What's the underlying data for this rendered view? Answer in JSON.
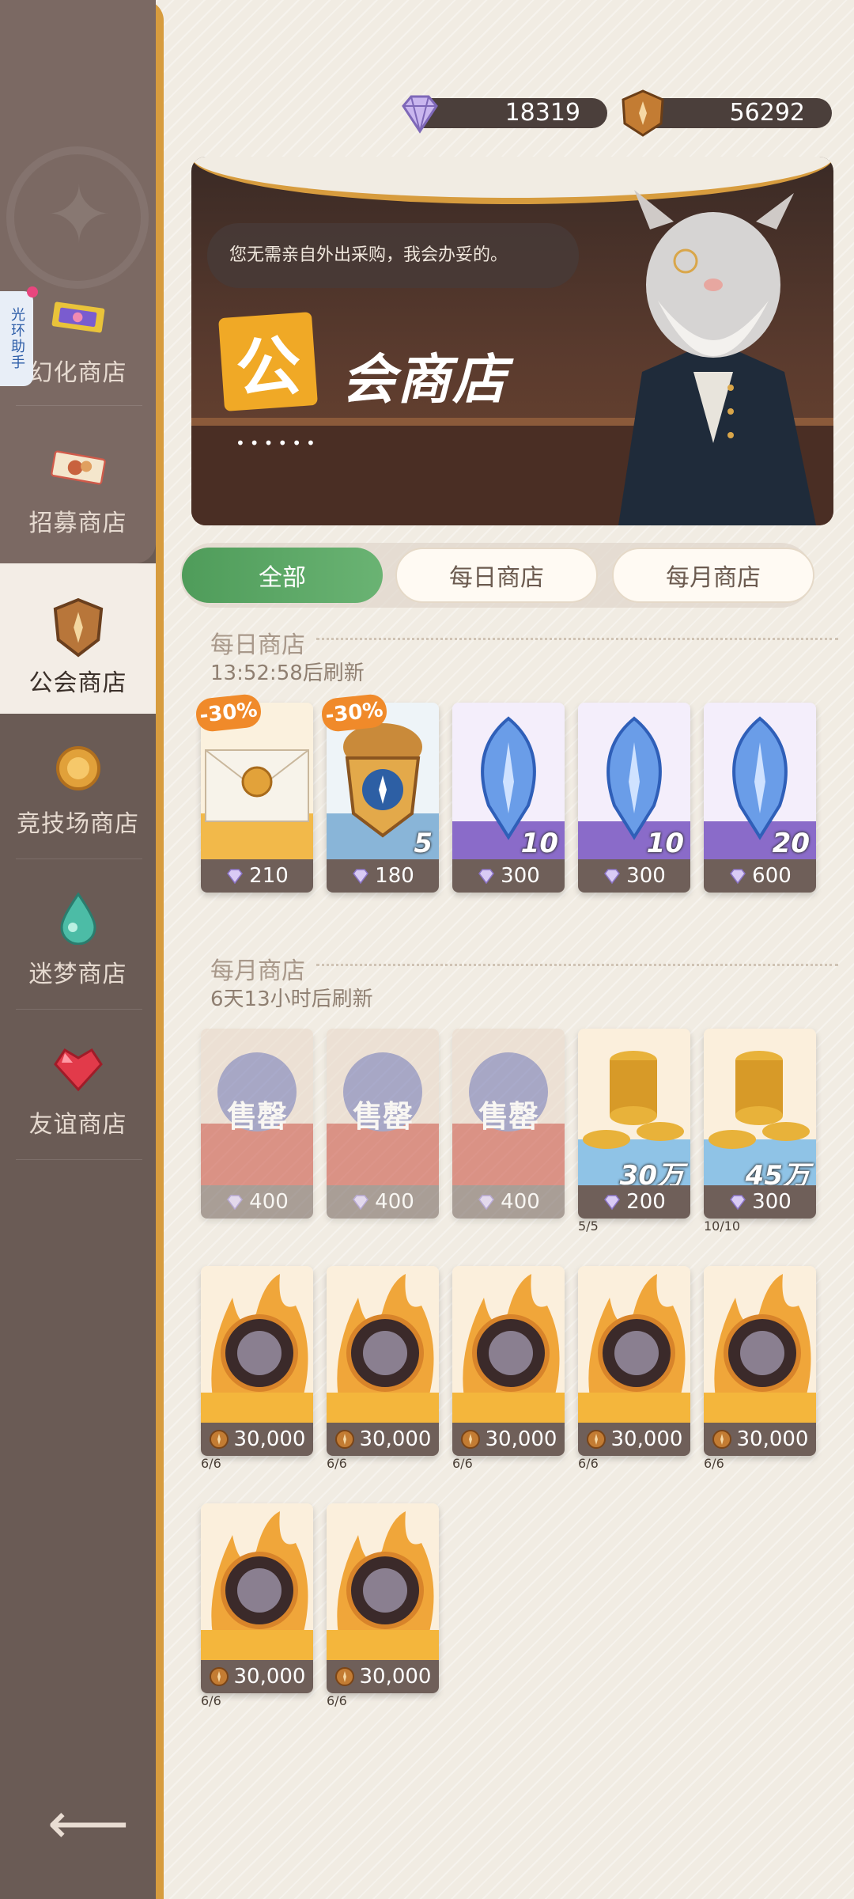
{
  "currencies": [
    {
      "name": "diamond",
      "value": "18319",
      "icon": "diamond-icon"
    },
    {
      "name": "guild-coin",
      "value": "56292",
      "icon": "guild-coin-icon"
    }
  ],
  "sidebar": {
    "helper_label": "光环助手",
    "items": [
      {
        "label": "幻化商店",
        "icon": "ticket-icon"
      },
      {
        "label": "招募商店",
        "icon": "recruit-ticket-icon"
      },
      {
        "label": "公会商店",
        "icon": "guild-shield-icon",
        "active": true
      },
      {
        "label": "竞技场商店",
        "icon": "arena-coin-icon"
      },
      {
        "label": "迷梦商店",
        "icon": "dream-drop-icon"
      },
      {
        "label": "友谊商店",
        "icon": "heart-gem-icon"
      }
    ]
  },
  "banner": {
    "speech": "您无需亲自外出采购，我会办妥的。",
    "title_first": "公",
    "title_rest": "会商店",
    "dots": "••••••"
  },
  "tabs": [
    {
      "label": "全部",
      "active": true
    },
    {
      "label": "每日商店",
      "active": false
    },
    {
      "label": "每月商店",
      "active": false
    }
  ],
  "daily": {
    "title": "每日商店",
    "refresh": "13:52:58后刷新",
    "items": [
      {
        "name": "letter",
        "discount": "-30%",
        "qty": "",
        "price": "210",
        "currency": "diamond",
        "color": "#f2b94a"
      },
      {
        "name": "acorn-badge",
        "discount": "-30%",
        "qty": "5",
        "price": "180",
        "currency": "diamond",
        "color": "#89b5d8"
      },
      {
        "name": "blue-crystal",
        "discount": "",
        "qty": "10",
        "price": "300",
        "currency": "diamond",
        "color": "#8a6bc9"
      },
      {
        "name": "blue-crystal",
        "discount": "",
        "qty": "10",
        "price": "300",
        "currency": "diamond",
        "color": "#8a6bc9"
      },
      {
        "name": "blue-crystal",
        "discount": "",
        "qty": "20",
        "price": "600",
        "currency": "diamond",
        "color": "#8a6bc9"
      }
    ]
  },
  "monthly": {
    "title": "每月商店",
    "refresh": "6天13小时后刷新",
    "sold_label": "售罄",
    "items": [
      {
        "name": "sold-item-1",
        "sold": true,
        "price": "400",
        "currency": "diamond",
        "limit": "",
        "qty": "",
        "color": "#c84a3a"
      },
      {
        "name": "sold-item-2",
        "sold": true,
        "price": "400",
        "currency": "diamond",
        "limit": "",
        "qty": "",
        "color": "#c84a3a"
      },
      {
        "name": "sold-item-3",
        "sold": true,
        "price": "400",
        "currency": "diamond",
        "limit": "",
        "qty": "",
        "color": "#c84a3a"
      },
      {
        "name": "gold-coins",
        "sold": false,
        "price": "200",
        "currency": "diamond",
        "limit": "5/5",
        "qty": "30万",
        "color": "#8fc3e6"
      },
      {
        "name": "gold-coins",
        "sold": false,
        "price": "300",
        "currency": "diamond",
        "limit": "10/10",
        "qty": "45万",
        "color": "#8fc3e6"
      },
      {
        "name": "hero-soul-1",
        "sold": false,
        "price": "30,000",
        "currency": "guild-coin",
        "limit": "6/6",
        "qty": "",
        "color": "#f0a63a"
      },
      {
        "name": "hero-soul-2",
        "sold": false,
        "price": "30,000",
        "currency": "guild-coin",
        "limit": "6/6",
        "qty": "",
        "color": "#f0a63a"
      },
      {
        "name": "hero-soul-3",
        "sold": false,
        "price": "30,000",
        "currency": "guild-coin",
        "limit": "6/6",
        "qty": "",
        "color": "#f0a63a"
      },
      {
        "name": "hero-soul-4",
        "sold": false,
        "price": "30,000",
        "currency": "guild-coin",
        "limit": "6/6",
        "qty": "",
        "color": "#f0a63a"
      },
      {
        "name": "hero-soul-5",
        "sold": false,
        "price": "30,000",
        "currency": "guild-coin",
        "limit": "6/6",
        "qty": "",
        "color": "#f0a63a"
      },
      {
        "name": "hero-soul-6",
        "sold": false,
        "price": "30,000",
        "currency": "guild-coin",
        "limit": "6/6",
        "qty": "",
        "color": "#f0a63a"
      },
      {
        "name": "hero-soul-7",
        "sold": false,
        "price": "30,000",
        "currency": "guild-coin",
        "limit": "6/6",
        "qty": "",
        "color": "#f0a63a"
      }
    ]
  },
  "back_icon": "back-arrow-icon"
}
